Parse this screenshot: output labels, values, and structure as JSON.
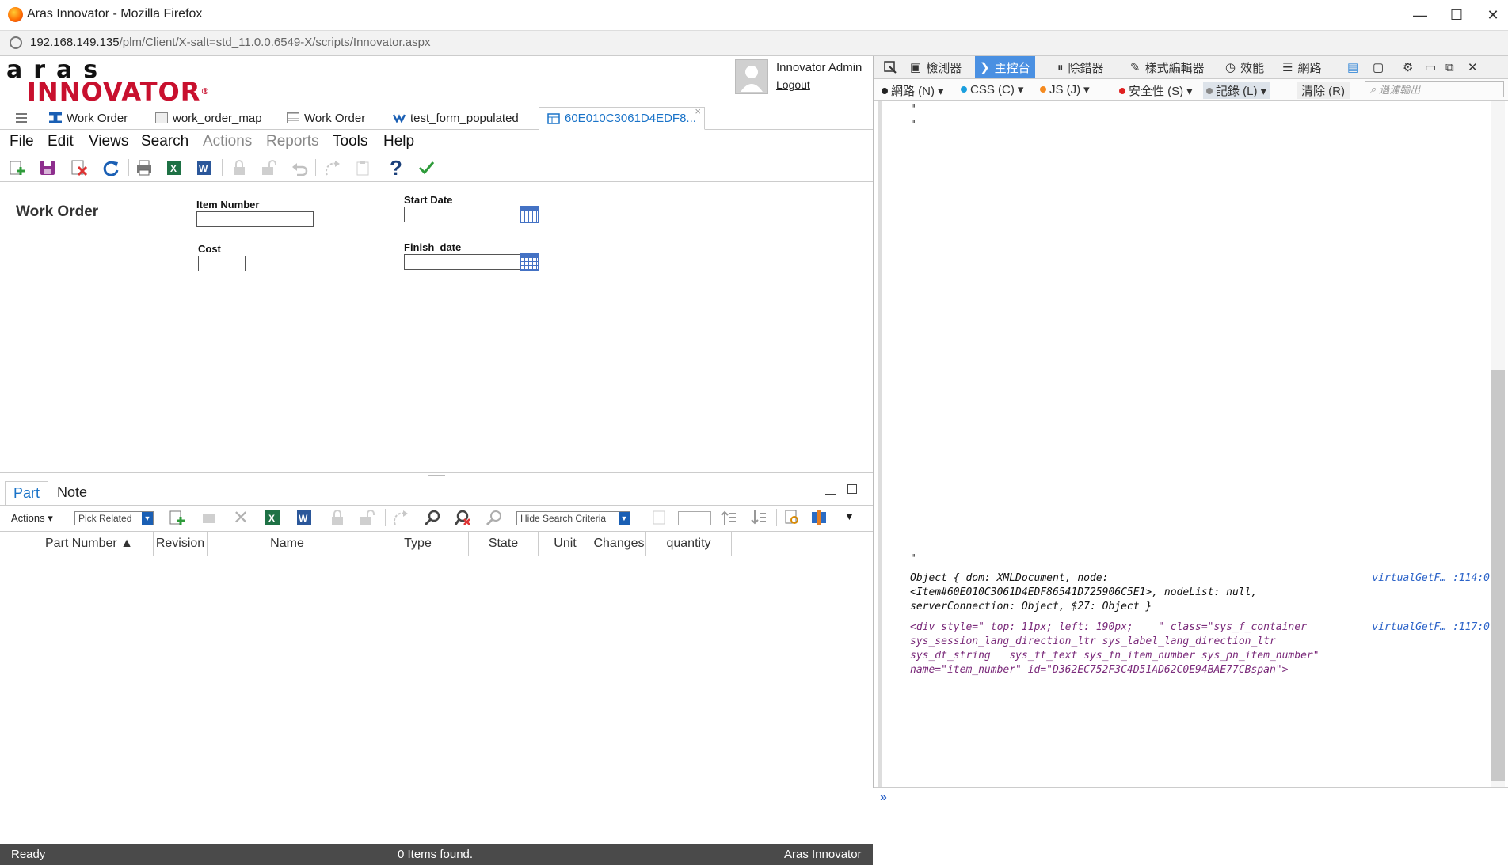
{
  "window": {
    "title": "Aras Innovator - Mozilla Firefox",
    "minimize": "—",
    "maximize": "☐",
    "close": "✕"
  },
  "urlbar": {
    "url_host": "192.168.149.135",
    "url_path": "/plm/Client/X-salt=std_11.0.0.6549-X/scripts/Innovator.aspx"
  },
  "app": {
    "logo": {
      "top": "aras",
      "bottom": "INNOVATOR",
      "reg": "®"
    },
    "user": {
      "name": "Innovator Admin",
      "logout": "Logout"
    },
    "tabs": [
      {
        "label": "Work Order",
        "icon": "work-order-icon"
      },
      {
        "label": "work_order_map",
        "icon": "map-icon"
      },
      {
        "label": "Work Order",
        "icon": "form-icon"
      },
      {
        "label": "test_form_populated",
        "icon": "workflow-icon"
      },
      {
        "label": "60E010C3061D4EDF8...",
        "icon": "item-icon",
        "close": "×"
      }
    ],
    "menu": [
      {
        "label": "File",
        "enabled": true
      },
      {
        "label": "Edit",
        "enabled": true
      },
      {
        "label": "Views",
        "enabled": true
      },
      {
        "label": "Search",
        "enabled": true
      },
      {
        "label": "Actions",
        "enabled": false
      },
      {
        "label": "Reports",
        "enabled": false
      },
      {
        "label": "Tools",
        "enabled": true
      },
      {
        "label": "Help",
        "enabled": true
      }
    ],
    "form": {
      "title": "Work Order",
      "fields": {
        "item_number": {
          "label": "Item Number",
          "value": ""
        },
        "cost": {
          "label": "Cost",
          "value": ""
        },
        "start_date": {
          "label": "Start Date",
          "value": ""
        },
        "finish_date": {
          "label": "Finish_date",
          "value": ""
        }
      }
    },
    "relationships": {
      "tabs": [
        "Part",
        "Note"
      ],
      "actions_label": "Actions",
      "pick_related": "Pick Related",
      "hide_search": "Hide Search Criteria",
      "columns": [
        "Part Number ▲",
        "Revision",
        "Name",
        "Type",
        "State",
        "Unit",
        "Changes",
        "quantity"
      ]
    },
    "status": {
      "left": "Ready",
      "center": "0 Items found.",
      "right": "Aras Innovator"
    }
  },
  "devtools": {
    "tabs": [
      "檢測器",
      "主控台",
      "除錯器",
      "樣式編輯器",
      "效能",
      "網路"
    ],
    "filters": [
      "網路 (N)",
      "CSS (C)",
      "JS (J)",
      "安全性 (S)",
      "記錄 (L)",
      "清除 (R)"
    ],
    "filter_placeholder": "過濾輸出",
    "console": {
      "q1": "\"",
      "q2": "\"",
      "q3": "\"",
      "log1_line1": "Object { dom: XMLDocument, node:",
      "log1_line2": "<Item#60E010C3061D4EDF86541D725906C5E1>, nodeList: null,",
      "log1_line3": "serverConnection: Object, $27: Object }",
      "log1_src": "virtualGetF… :114:0",
      "log2_line1": "<div style=\" top: 11px; left: 190px;    \" class=\"sys_f_container",
      "log2_line2": "sys_session_lang_direction_ltr sys_label_lang_direction_ltr",
      "log2_line3": "sys_dt_string   sys_ft_text sys_fn_item_number sys_pn_item_number\"",
      "log2_line4": "name=\"item_number\" id=\"D362EC752F3C4D51AD62C0E94BAE77CBspan\">",
      "log2_src": "virtualGetF… :117:0",
      "prompt": "»"
    }
  },
  "colors": {
    "accent": "#1a73c8",
    "brand_red": "#c8102e",
    "status_bg": "#4a4a4a",
    "devtools_active": "#4a90e2"
  }
}
